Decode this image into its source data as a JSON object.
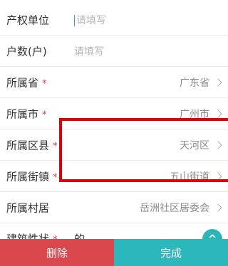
{
  "form": {
    "rows": [
      {
        "label": "产权单位",
        "placeholder": "请填写",
        "required": false
      },
      {
        "label": "户数(户)",
        "placeholder": "请填写",
        "required": false
      },
      {
        "label": "所属省",
        "value": "广东省",
        "required": true
      },
      {
        "label": "所属市",
        "value": "广州市",
        "required": true
      },
      {
        "label": "所属区县",
        "value": "天河区",
        "required": true
      },
      {
        "label": "所属街镇",
        "value": "五山街道",
        "required": true
      },
      {
        "label": "所属村居",
        "value": "岳洲社区居委会",
        "required": false
      }
    ],
    "partial_row": {
      "label": "建筑性状",
      "value": "的"
    },
    "required_mark": "*"
  },
  "fab": {
    "icon": "chevron-up-icon",
    "glyph": "^"
  },
  "bottom_bar": {
    "delete_label": "删除",
    "done_label": "完成"
  },
  "colors": {
    "accent": "#2cb7bc",
    "danger": "#d9464b",
    "highlight": "#e00000"
  }
}
